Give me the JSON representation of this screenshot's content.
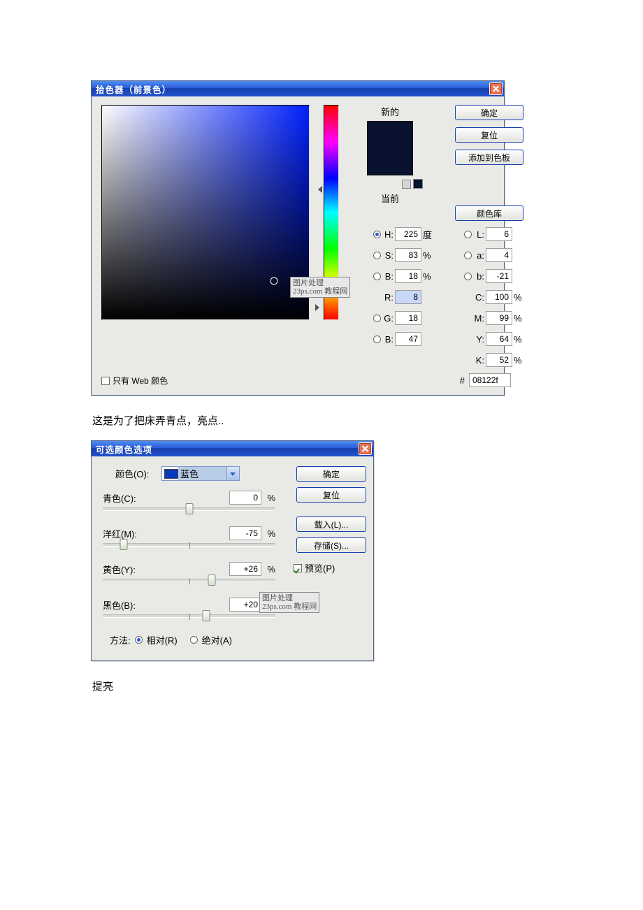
{
  "colorPicker": {
    "title": "拾色器（前景色）",
    "newLabel": "新的",
    "currentLabel": "当前",
    "webOnlyLabel": "只有 Web 颜色",
    "hex": "08122f",
    "hexPrefix": "#",
    "H": "225",
    "H_unit": "度",
    "S": "83",
    "S_unit": "%",
    "Bv": "18",
    "Bv_unit": "%",
    "R": "8",
    "G": "18",
    "Bc": "47",
    "L": "6",
    "a": "4",
    "b": "-21",
    "C": "100",
    "M": "99",
    "Y": "64",
    "K": "52",
    "lab_H": "H:",
    "lab_S": "S:",
    "lab_Bv": "B:",
    "lab_R": "R:",
    "lab_G": "G:",
    "lab_Bc": "B:",
    "lab_L": "L:",
    "lab_a": "a:",
    "lab_b": "b:",
    "lab_C": "C:",
    "lab_M": "M:",
    "lab_Y": "Y:",
    "lab_K": "K:",
    "pct": "%",
    "buttons": {
      "ok": "确定",
      "reset": "复位",
      "addSwatch": "添加到色板",
      "colorLib": "颜色库"
    },
    "watermark_l1": "图片处理",
    "watermark_l2": "23ps.com 教程网"
  },
  "caption1": "这是为了把床弄青点，亮点..",
  "selColor": {
    "title": "可选颜色选项",
    "colorLabel": "颜色(O):",
    "colorName": "蓝色",
    "cyan": {
      "label": "青色(C):",
      "value": "0"
    },
    "magenta": {
      "label": "洋红(M):",
      "value": "-75"
    },
    "yellow": {
      "label": "黄色(Y):",
      "value": "+26"
    },
    "black": {
      "label": "黑色(B):",
      "value": "+20"
    },
    "pct": "%",
    "methodLabel": "方法:",
    "relative": "相对(R)",
    "absolute": "绝对(A)",
    "buttons": {
      "ok": "确定",
      "reset": "复位",
      "load": "载入(L)...",
      "save": "存储(S)..."
    },
    "previewLabel": "预览(P)",
    "watermark_l1": "图片处理",
    "watermark_l2": "23ps.com 教程网"
  },
  "caption2": "提亮"
}
